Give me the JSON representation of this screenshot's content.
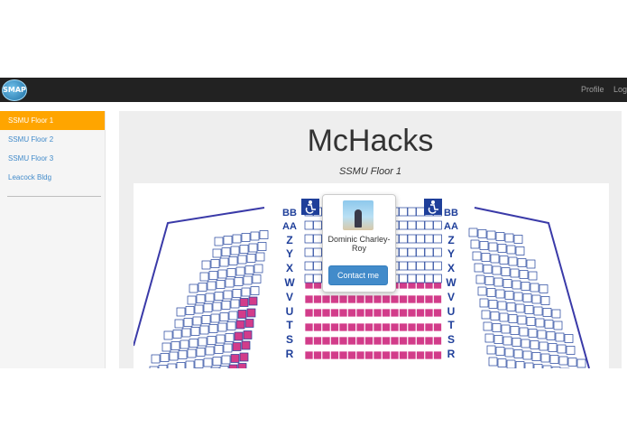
{
  "navbar": {
    "logo_text": "SMAP",
    "links": [
      "Profile",
      "Logout"
    ]
  },
  "sidebar": {
    "items": [
      {
        "label": "SSMU Floor 1",
        "active": true
      },
      {
        "label": "SSMU Floor 2",
        "active": false
      },
      {
        "label": "SSMU Floor 3",
        "active": false
      },
      {
        "label": "Leacock Bldg",
        "active": false
      }
    ]
  },
  "main": {
    "title": "McHacks",
    "subtitle": "SSMU Floor 1"
  },
  "seatmap": {
    "rows_left": [
      "BB",
      "AA",
      "Z",
      "Y",
      "X",
      "W",
      "V",
      "U",
      "T",
      "S",
      "R"
    ],
    "rows_right": [
      "BB",
      "AA",
      "Z",
      "Y",
      "X",
      "W",
      "V",
      "U",
      "T",
      "S",
      "R"
    ],
    "accessible_icon": "wheelchair-icon"
  },
  "popover": {
    "name": "Dominic Charley-Roy",
    "button": "Contact me"
  },
  "colors": {
    "navbar": "#222222",
    "active": "#ffa500",
    "link": "#428bca",
    "seat_pink": "#d23c8a",
    "accessible_blue": "#1f3f9a"
  }
}
